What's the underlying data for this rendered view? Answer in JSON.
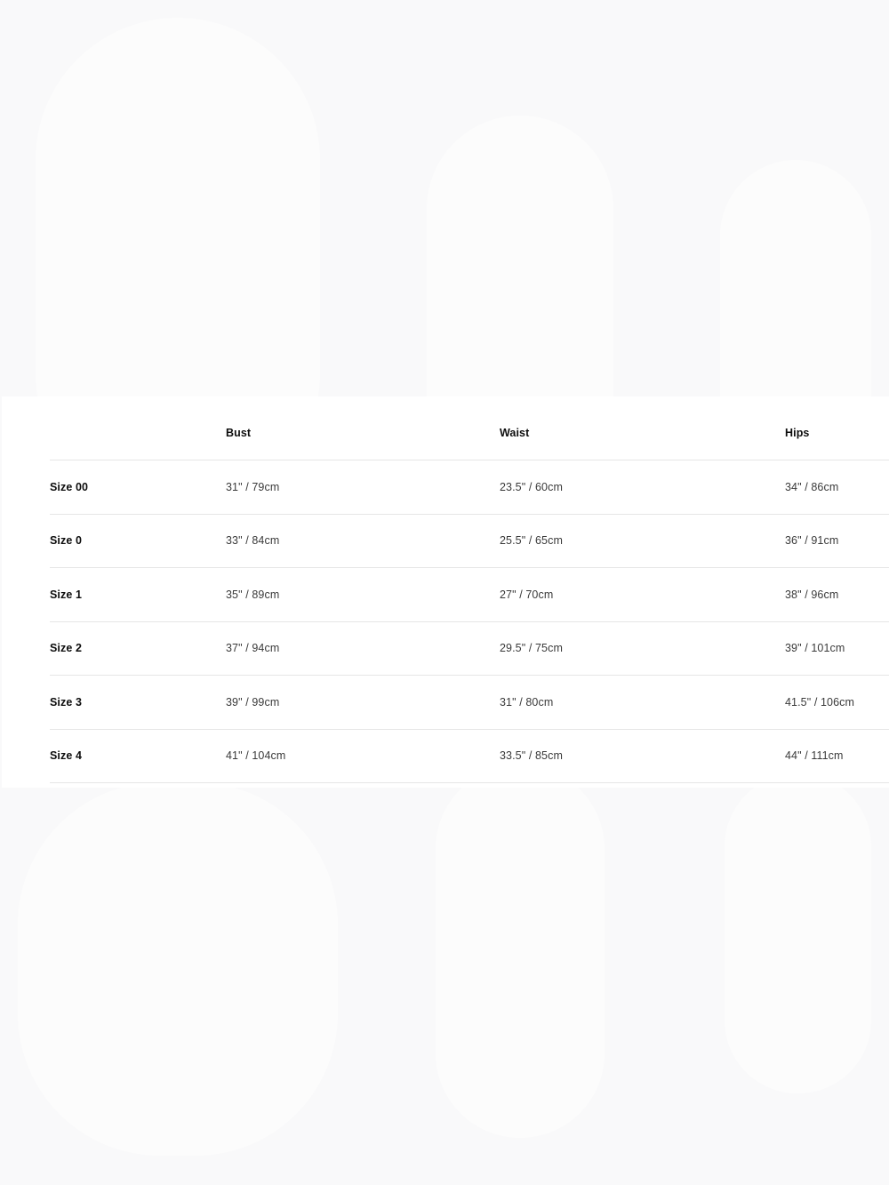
{
  "size_chart": {
    "columns": [
      "",
      "Bust",
      "Waist",
      "Hips"
    ],
    "rows": [
      {
        "size": "Size 00",
        "bust": "31\" / 79cm",
        "waist": "23.5\" / 60cm",
        "hips": "34\" / 86cm"
      },
      {
        "size": "Size 0",
        "bust": "33\" / 84cm",
        "waist": "25.5\" / 65cm",
        "hips": "36\" / 91cm"
      },
      {
        "size": "Size 1",
        "bust": "35\" / 89cm",
        "waist": "27\" / 70cm",
        "hips": "38\" / 96cm"
      },
      {
        "size": "Size 2",
        "bust": "37\" / 94cm",
        "waist": "29.5\" / 75cm",
        "hips": "39\" / 101cm"
      },
      {
        "size": "Size 3",
        "bust": "39\" / 99cm",
        "waist": "31\" / 80cm",
        "hips": "41.5\" / 106cm"
      },
      {
        "size": "Size 4",
        "bust": "41\" / 104cm",
        "waist": "33.5\" / 85cm",
        "hips": "44\" / 111cm"
      }
    ]
  }
}
